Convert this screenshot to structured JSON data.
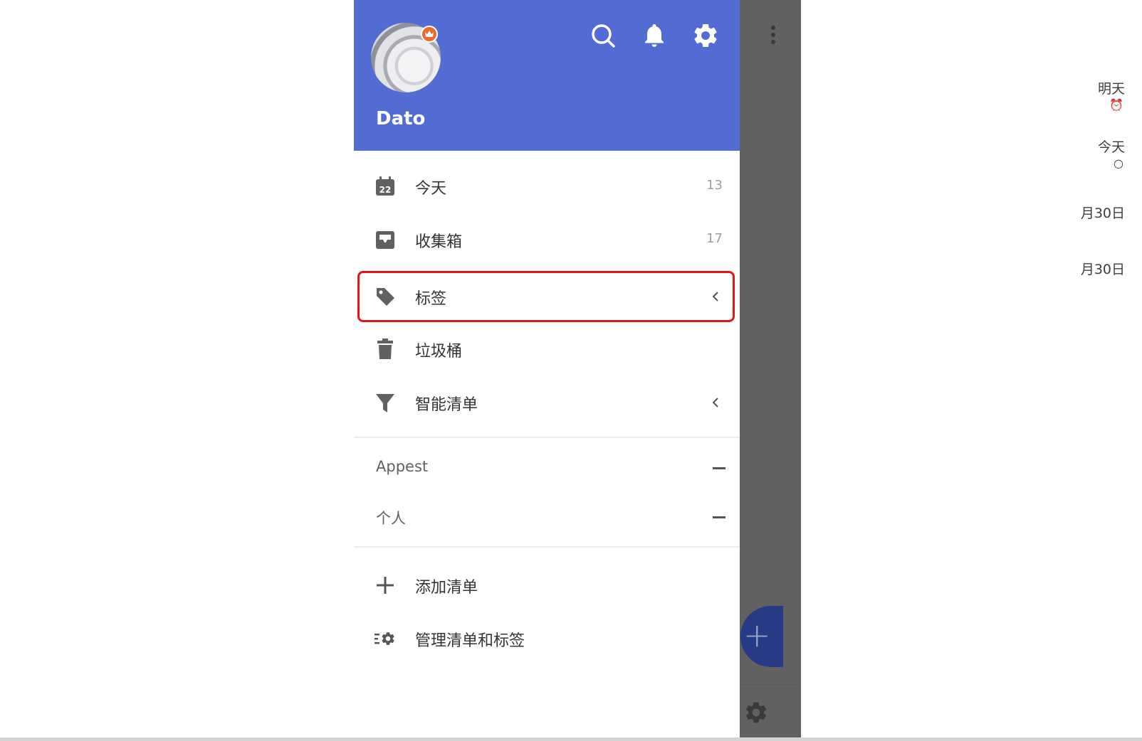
{
  "header": {
    "username": "Dato",
    "icons": [
      "search-icon",
      "bell-icon",
      "gear-icon"
    ],
    "avatar_badge": "crown-icon"
  },
  "menu": [
    {
      "label": "今天",
      "count": "13",
      "icon": "calendar-icon",
      "calendar_day": "22"
    },
    {
      "label": "收集箱",
      "count": "17",
      "icon": "inbox-icon"
    },
    {
      "label": "标签",
      "icon": "tag-icon",
      "has_chevron": true,
      "highlighted": true
    },
    {
      "label": "垃圾桶",
      "icon": "trash-icon"
    },
    {
      "label": "智能清单",
      "icon": "filter-icon",
      "has_chevron": true
    }
  ],
  "groups": [
    {
      "label": "Appest"
    },
    {
      "label": "个人"
    }
  ],
  "actions": [
    {
      "label": "添加清单",
      "icon": "plus-icon"
    },
    {
      "label": "管理清单和标签",
      "icon": "manage-settings-icon"
    }
  ],
  "background_panel": {
    "items": [
      "明天",
      "今天",
      "月30日",
      "月30日"
    ]
  },
  "colors": {
    "header_bg": "#526cd4",
    "highlight_border": "#e3151c",
    "badge": "#f0682a",
    "fab": "#263a86"
  }
}
